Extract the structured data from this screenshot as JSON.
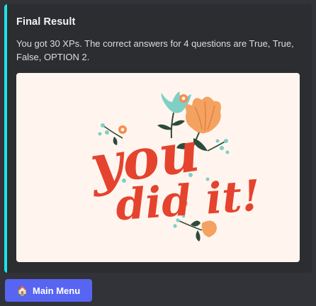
{
  "embed": {
    "accent_color": "#1ee3e7",
    "title": "Final Result",
    "description": "You got 30 XPs. The correct answers for 4 questions are True, True, False, OPTION 2.",
    "image": {
      "background_color": "#fff5ee",
      "word_line1": "you",
      "word_line2": "did it!"
    }
  },
  "actions": {
    "main_menu": {
      "icon": "house-emoji-icon",
      "icon_glyph": "🏠",
      "label": "Main Menu"
    }
  }
}
